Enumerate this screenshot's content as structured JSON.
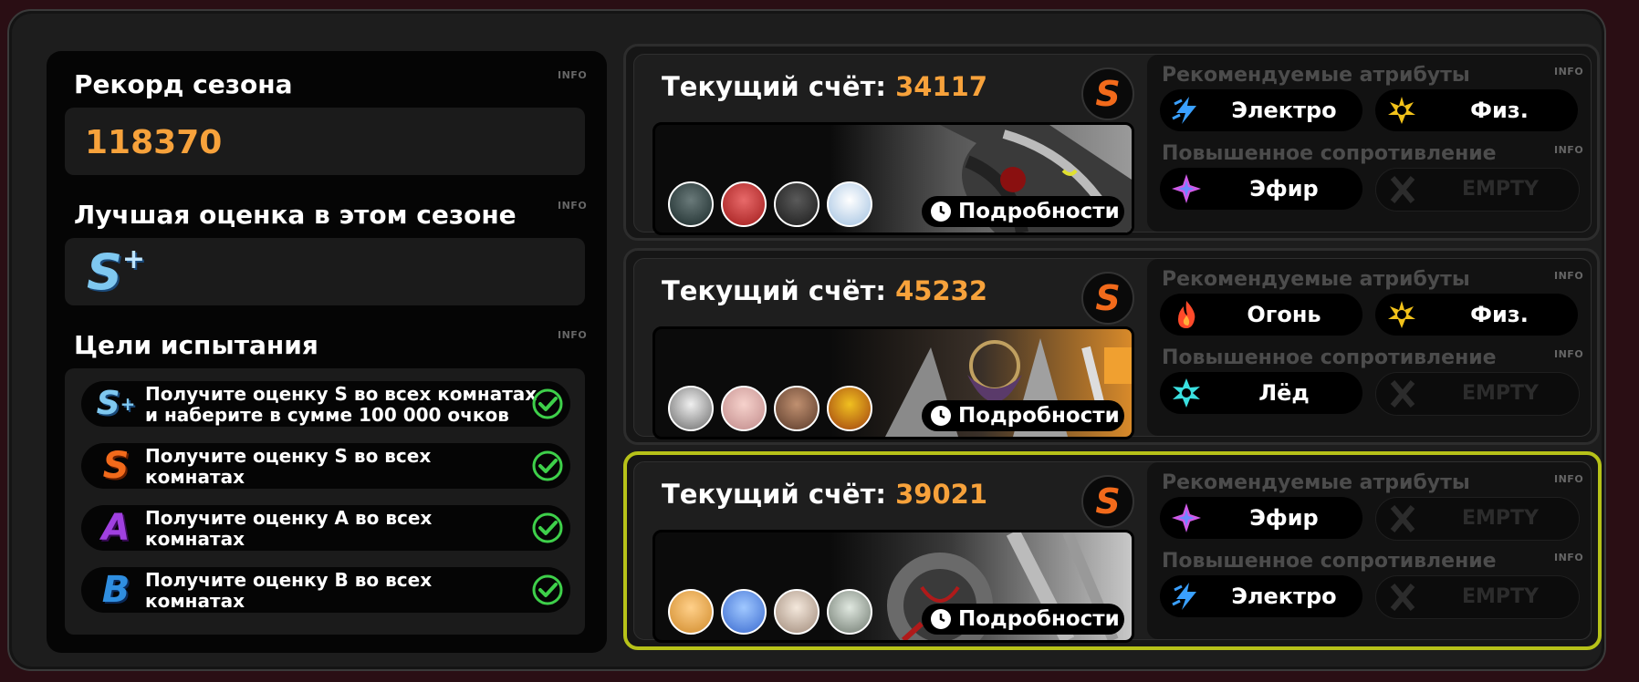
{
  "left": {
    "season_record": {
      "title": "Рекорд сезона",
      "info": "INFO",
      "value": "118370"
    },
    "best_grade": {
      "title": "Лучшая оценка в этом сезоне",
      "info": "INFO",
      "grade": "S",
      "grade_plus": "+"
    },
    "goals": {
      "title": "Цели испытания",
      "info": "INFO",
      "items": [
        {
          "badge": "S+",
          "text": "Получите оценку S во всех комнатах и наберите в сумме 100 000 очков",
          "done": true
        },
        {
          "badge": "S",
          "text": "Получите оценку S во всех комнатах",
          "done": true
        },
        {
          "badge": "A",
          "text": "Получите оценку A во всех комнатах",
          "done": true
        },
        {
          "badge": "B",
          "text": "Получите оценку B во всех комнатах",
          "done": true
        }
      ]
    }
  },
  "cards": [
    {
      "score_label": "Текущий счёт:",
      "score": "34117",
      "grade": "S",
      "details": "Подробности",
      "recommended_title": "Рекомендуемые атрибуты",
      "recommended_info": "INFO",
      "recommended": [
        {
          "icon": "electro-icon",
          "label": "Электро"
        },
        {
          "icon": "physical-icon",
          "label": "Физ."
        }
      ],
      "resist_title": "Повышенное сопротивление",
      "resist_info": "INFO",
      "resist": [
        {
          "icon": "ether-icon",
          "label": "Эфир"
        },
        {
          "icon": "empty-icon",
          "label": "EMPTY"
        }
      ]
    },
    {
      "score_label": "Текущий счёт:",
      "score": "45232",
      "grade": "S",
      "details": "Подробности",
      "recommended_title": "Рекомендуемые атрибуты",
      "recommended_info": "INFO",
      "recommended": [
        {
          "icon": "fire-icon",
          "label": "Огонь"
        },
        {
          "icon": "physical-icon",
          "label": "Физ."
        }
      ],
      "resist_title": "Повышенное сопротивление",
      "resist_info": "INFO",
      "resist": [
        {
          "icon": "ice-icon",
          "label": "Лёд"
        },
        {
          "icon": "empty-icon",
          "label": "EMPTY"
        }
      ]
    },
    {
      "score_label": "Текущий счёт:",
      "score": "39021",
      "grade": "S",
      "details": "Подробности",
      "recommended_title": "Рекомендуемые атрибуты",
      "recommended_info": "INFO",
      "recommended": [
        {
          "icon": "ether-icon",
          "label": "Эфир"
        },
        {
          "icon": "empty-icon",
          "label": "EMPTY"
        }
      ],
      "resist_title": "Повышенное сопротивление",
      "resist_info": "INFO",
      "resist": [
        {
          "icon": "electro-icon",
          "label": "Электро"
        },
        {
          "icon": "empty-icon",
          "label": "EMPTY"
        }
      ]
    }
  ],
  "colors": {
    "score_accent": "#f7a23b",
    "grade_s": "#f26a1b",
    "grade_splus": "#7fc8f0",
    "grade_a": "#a040e0",
    "grade_b": "#2f8ee0",
    "check_green": "#3ed04a",
    "active_border": "#b7c219"
  }
}
